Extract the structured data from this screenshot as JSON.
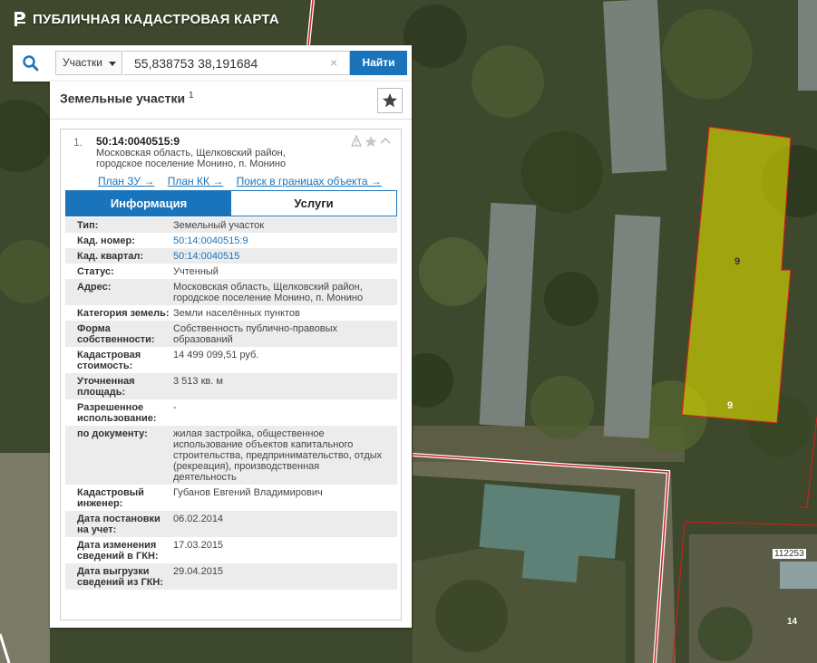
{
  "header": {
    "title": "ПУБЛИЧНАЯ КАДАСТРОВАЯ КАРТА",
    "logo_icon": "rosreestr-logo-icon"
  },
  "search": {
    "type_selected": "Участки",
    "query": "55,838753 38,191684",
    "clear_icon": "×",
    "button_label": "Найти",
    "search_icon": "search-icon"
  },
  "panel": {
    "title": "Земельные участки",
    "count": "1",
    "favorite_icon": "star-icon"
  },
  "result": {
    "index": "1.",
    "cad_number": "50:14:0040515:9",
    "address": "Московская область, Щелковский район, городское поселение Монино, п. Монино",
    "links": [
      "План ЗУ →",
      "План КК →",
      "Поиск в границах объекта →"
    ],
    "tabs": {
      "info": "Информация",
      "services": "Услуги"
    },
    "rows": [
      {
        "label": "Тип:",
        "value": "Земельный участок",
        "link": false
      },
      {
        "label": "Кад. номер:",
        "value": "50:14:0040515:9",
        "link": true
      },
      {
        "label": "Кад. квартал:",
        "value": "50:14:0040515",
        "link": true
      },
      {
        "label": "Статус:",
        "value": "Учтенный",
        "link": false
      },
      {
        "label": "Адрес:",
        "value": "Московская область, Щелковский район, городское поселение Монино, п. Монино",
        "link": false
      },
      {
        "label": "Категория земель:",
        "value": "Земли населённых пунктов",
        "link": false
      },
      {
        "label": "Форма собственности:",
        "value": "Собственность публично-правовых образований",
        "link": false
      },
      {
        "label": "Кадастровая стоимость:",
        "value": "14 499 099,51 руб.",
        "link": false
      },
      {
        "label": "Уточненная площадь:",
        "value": "3 513 кв. м",
        "link": false
      },
      {
        "label": "Разрешенное использование:",
        "value": "-",
        "link": false
      },
      {
        "label": "по документу:",
        "value": "жилая застройка, общественное использование объектов капитального строительства, предпринимательство, отдых (рекреация), производственная деятельность",
        "link": false
      },
      {
        "label": "Кадастровый инженер:",
        "value": "Губанов Евгений Владимирович",
        "link": false
      },
      {
        "label": "Дата постановки на учет:",
        "value": "06.02.2014",
        "link": false
      },
      {
        "label": "Дата изменения сведений в ГКН:",
        "value": "17.03.2015",
        "link": false
      },
      {
        "label": "Дата выгрузки сведений из ГКН:",
        "value": "29.04.2015",
        "link": false
      }
    ]
  },
  "map": {
    "plot_labels": [
      "9",
      "9",
      "112253",
      "14"
    ],
    "highlight_color": "#d6d600",
    "boundary_color": "#cc1f1f"
  }
}
